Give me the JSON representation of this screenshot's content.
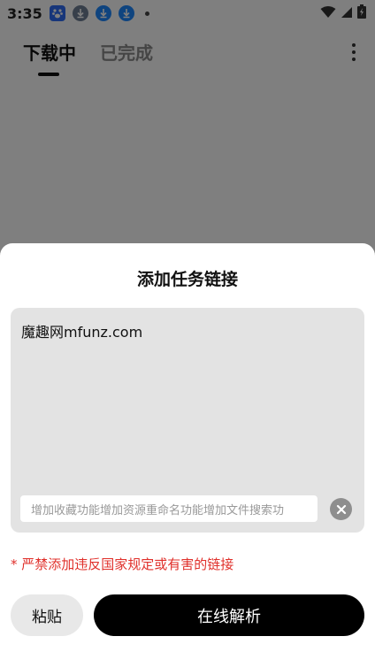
{
  "status_bar": {
    "time": "3:35",
    "notification_icons": [
      "baidu-icon",
      "download-icon",
      "download-icon",
      "download-icon"
    ],
    "system_icons": [
      "wifi-icon",
      "signal-icon",
      "battery-charging-icon"
    ]
  },
  "header": {
    "tabs": [
      {
        "label": "下载中",
        "active": true
      },
      {
        "label": "已完成",
        "active": false
      }
    ],
    "more_icon": "more-vertical-icon"
  },
  "sheet": {
    "title": "添加任务链接",
    "link_value": "魔趣网mfunz.com",
    "name_input_placeholder": "增加收藏功能增加资源重命名功能增加文件搜索功",
    "clear_icon": "clear-circle-icon",
    "warning": "* 严禁添加违反国家规定或有害的链接",
    "paste_label": "粘贴",
    "parse_label": "在线解析"
  },
  "colors": {
    "accent": "#000000",
    "warning": "#e0302b",
    "input_bg": "#e3e3e3"
  }
}
